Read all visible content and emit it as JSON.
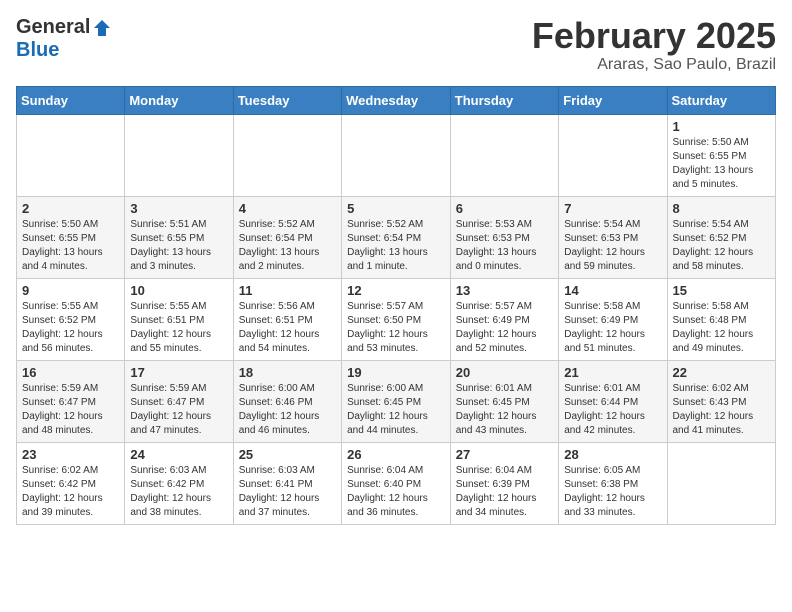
{
  "logo": {
    "general": "General",
    "blue": "Blue"
  },
  "header": {
    "month": "February 2025",
    "location": "Araras, Sao Paulo, Brazil"
  },
  "days_of_week": [
    "Sunday",
    "Monday",
    "Tuesday",
    "Wednesday",
    "Thursday",
    "Friday",
    "Saturday"
  ],
  "weeks": [
    [
      {
        "day": "",
        "info": ""
      },
      {
        "day": "",
        "info": ""
      },
      {
        "day": "",
        "info": ""
      },
      {
        "day": "",
        "info": ""
      },
      {
        "day": "",
        "info": ""
      },
      {
        "day": "",
        "info": ""
      },
      {
        "day": "1",
        "info": "Sunrise: 5:50 AM\nSunset: 6:55 PM\nDaylight: 13 hours\nand 5 minutes."
      }
    ],
    [
      {
        "day": "2",
        "info": "Sunrise: 5:50 AM\nSunset: 6:55 PM\nDaylight: 13 hours\nand 4 minutes."
      },
      {
        "day": "3",
        "info": "Sunrise: 5:51 AM\nSunset: 6:55 PM\nDaylight: 13 hours\nand 3 minutes."
      },
      {
        "day": "4",
        "info": "Sunrise: 5:52 AM\nSunset: 6:54 PM\nDaylight: 13 hours\nand 2 minutes."
      },
      {
        "day": "5",
        "info": "Sunrise: 5:52 AM\nSunset: 6:54 PM\nDaylight: 13 hours\nand 1 minute."
      },
      {
        "day": "6",
        "info": "Sunrise: 5:53 AM\nSunset: 6:53 PM\nDaylight: 13 hours\nand 0 minutes."
      },
      {
        "day": "7",
        "info": "Sunrise: 5:54 AM\nSunset: 6:53 PM\nDaylight: 12 hours\nand 59 minutes."
      },
      {
        "day": "8",
        "info": "Sunrise: 5:54 AM\nSunset: 6:52 PM\nDaylight: 12 hours\nand 58 minutes."
      }
    ],
    [
      {
        "day": "9",
        "info": "Sunrise: 5:55 AM\nSunset: 6:52 PM\nDaylight: 12 hours\nand 56 minutes."
      },
      {
        "day": "10",
        "info": "Sunrise: 5:55 AM\nSunset: 6:51 PM\nDaylight: 12 hours\nand 55 minutes."
      },
      {
        "day": "11",
        "info": "Sunrise: 5:56 AM\nSunset: 6:51 PM\nDaylight: 12 hours\nand 54 minutes."
      },
      {
        "day": "12",
        "info": "Sunrise: 5:57 AM\nSunset: 6:50 PM\nDaylight: 12 hours\nand 53 minutes."
      },
      {
        "day": "13",
        "info": "Sunrise: 5:57 AM\nSunset: 6:49 PM\nDaylight: 12 hours\nand 52 minutes."
      },
      {
        "day": "14",
        "info": "Sunrise: 5:58 AM\nSunset: 6:49 PM\nDaylight: 12 hours\nand 51 minutes."
      },
      {
        "day": "15",
        "info": "Sunrise: 5:58 AM\nSunset: 6:48 PM\nDaylight: 12 hours\nand 49 minutes."
      }
    ],
    [
      {
        "day": "16",
        "info": "Sunrise: 5:59 AM\nSunset: 6:47 PM\nDaylight: 12 hours\nand 48 minutes."
      },
      {
        "day": "17",
        "info": "Sunrise: 5:59 AM\nSunset: 6:47 PM\nDaylight: 12 hours\nand 47 minutes."
      },
      {
        "day": "18",
        "info": "Sunrise: 6:00 AM\nSunset: 6:46 PM\nDaylight: 12 hours\nand 46 minutes."
      },
      {
        "day": "19",
        "info": "Sunrise: 6:00 AM\nSunset: 6:45 PM\nDaylight: 12 hours\nand 44 minutes."
      },
      {
        "day": "20",
        "info": "Sunrise: 6:01 AM\nSunset: 6:45 PM\nDaylight: 12 hours\nand 43 minutes."
      },
      {
        "day": "21",
        "info": "Sunrise: 6:01 AM\nSunset: 6:44 PM\nDaylight: 12 hours\nand 42 minutes."
      },
      {
        "day": "22",
        "info": "Sunrise: 6:02 AM\nSunset: 6:43 PM\nDaylight: 12 hours\nand 41 minutes."
      }
    ],
    [
      {
        "day": "23",
        "info": "Sunrise: 6:02 AM\nSunset: 6:42 PM\nDaylight: 12 hours\nand 39 minutes."
      },
      {
        "day": "24",
        "info": "Sunrise: 6:03 AM\nSunset: 6:42 PM\nDaylight: 12 hours\nand 38 minutes."
      },
      {
        "day": "25",
        "info": "Sunrise: 6:03 AM\nSunset: 6:41 PM\nDaylight: 12 hours\nand 37 minutes."
      },
      {
        "day": "26",
        "info": "Sunrise: 6:04 AM\nSunset: 6:40 PM\nDaylight: 12 hours\nand 36 minutes."
      },
      {
        "day": "27",
        "info": "Sunrise: 6:04 AM\nSunset: 6:39 PM\nDaylight: 12 hours\nand 34 minutes."
      },
      {
        "day": "28",
        "info": "Sunrise: 6:05 AM\nSunset: 6:38 PM\nDaylight: 12 hours\nand 33 minutes."
      },
      {
        "day": "",
        "info": ""
      }
    ]
  ]
}
